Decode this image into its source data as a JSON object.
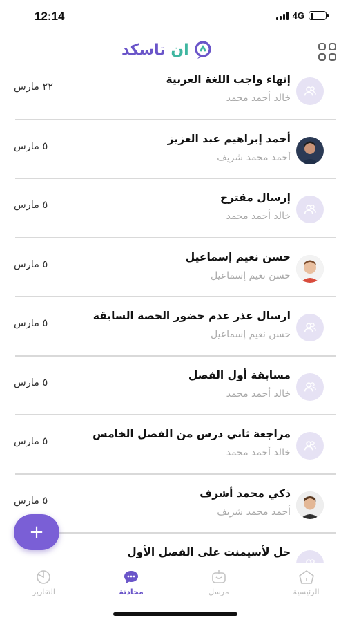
{
  "status_bar": {
    "time": "12:14",
    "network": "4G",
    "battery_level": 0.2
  },
  "header": {
    "logo_main": "تاسكد",
    "logo_accent": "ان",
    "menu_icon": "grid-icon"
  },
  "conversations": [
    {
      "title": "إنهاء واجب اللغة العربية",
      "subtitle": "خالد أحمد محمد",
      "date": "٢٢ مارس",
      "avatar": "group-icon"
    },
    {
      "title": "أحمد إبراهيم عبد العزيز",
      "subtitle": "أحمد محمد شريف",
      "date": "٥ مارس",
      "avatar": "photo"
    },
    {
      "title": "إرسال مقترح",
      "subtitle": "خالد أحمد محمد",
      "date": "٥ مارس",
      "avatar": "group-icon"
    },
    {
      "title": "حسن نعيم إسماعيل",
      "subtitle": "حسن نعيم إسماعيل",
      "date": "٥ مارس",
      "avatar": "photo"
    },
    {
      "title": "ارسال عذر عدم حضور الحصة السابقة",
      "subtitle": "حسن نعيم إسماعيل",
      "date": "٥ مارس",
      "avatar": "group-icon"
    },
    {
      "title": "مسابقة أول الفصل",
      "subtitle": "خالد أحمد محمد",
      "date": "٥ مارس",
      "avatar": "group-icon"
    },
    {
      "title": "مراجعة ثاني درس من الفصل الخامس",
      "subtitle": "خالد أحمد محمد",
      "date": "٥ مارس",
      "avatar": "group-icon"
    },
    {
      "title": "ذكي محمد أشرف",
      "subtitle": "أحمد محمد شريف",
      "date": "٥ مارس",
      "avatar": "photo"
    },
    {
      "title": "حل لأسيمنت على الفصل الأول",
      "subtitle": "",
      "date": "",
      "avatar": "group-icon"
    }
  ],
  "fab": {
    "label": "+"
  },
  "tabbar": {
    "reports": "التقارير",
    "chat": "محادثة",
    "sent": "مرسل",
    "home": "الرئيسية",
    "active": "chat"
  },
  "colors": {
    "accent": "#6a55c9",
    "accent_light": "#e6e2f4",
    "teal": "#3fb6a0"
  }
}
